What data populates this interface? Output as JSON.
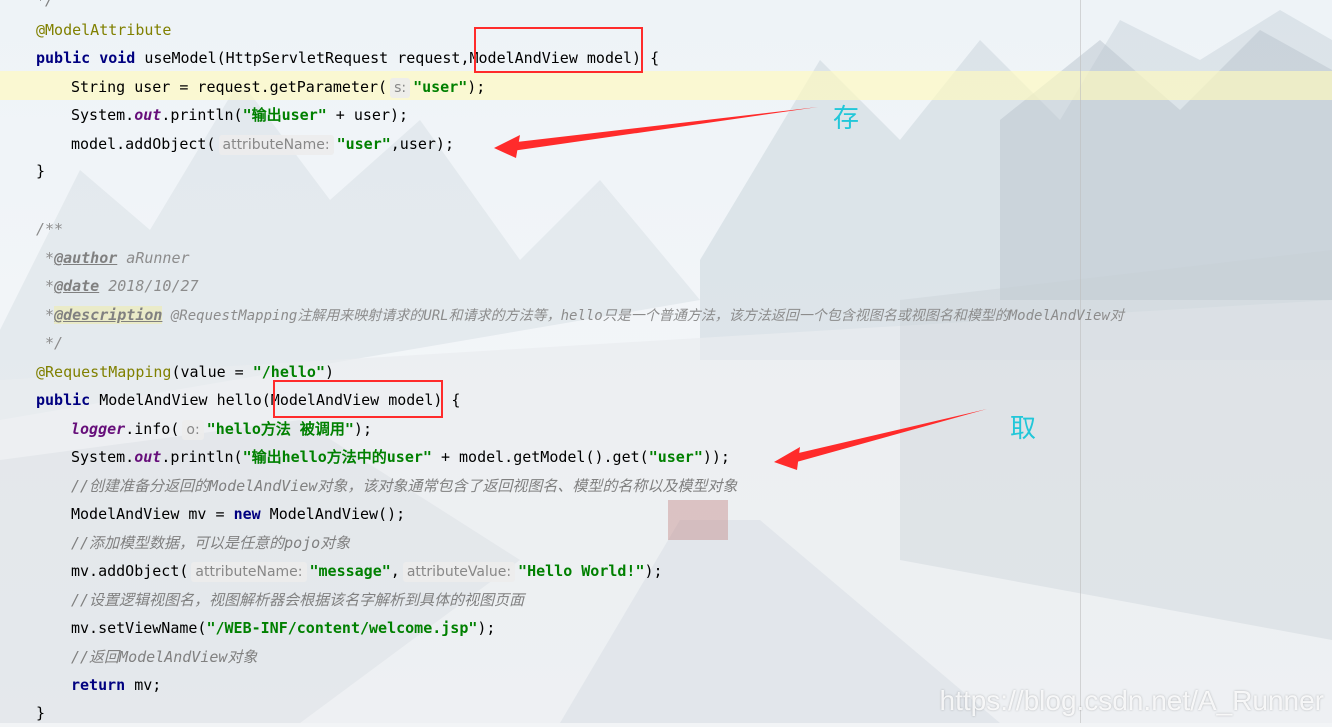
{
  "code_lines": {
    "l0": "*/",
    "l1_ann": "@ModelAttribute",
    "l2_kw": "public void",
    "l2_rest": " useModel(HttpServletRequest request,ModelAndView model) {",
    "l3_a": "String user = request.getParameter(",
    "l3_hint": "s:",
    "l3_str": "\"user\"",
    "l3_b": ");",
    "l4_a": "System.",
    "l4_fld": "out",
    "l4_b": ".println(",
    "l4_str": "\"输出user\"",
    "l4_c": " + user);",
    "l5_a": "model.addObject(",
    "l5_hint": "attributeName:",
    "l5_str": "\"user\"",
    "l5_b": ",user);",
    "l6": "}",
    "l8": "/**",
    "l9_star": " *",
    "l9_tag": "@author",
    "l9_rest": " aRunner",
    "l10_star": " *",
    "l10_tag": "@date",
    "l10_rest": " 2018/10/27",
    "l11_star": " *",
    "l11_tag": "@description",
    "l11_rest": " @RequestMapping注解用来映射请求的URL和请求的方法等，hello只是一个普通方法，该方法返回一个包含视图名或视图名和模型的ModelAndView对",
    "l12": " */",
    "l13_ann": "@RequestMapping",
    "l13_a": "(value = ",
    "l13_str": "\"/hello\"",
    "l13_b": ")",
    "l14_kw": "public",
    "l14_rest": " ModelAndView hello(ModelAndView model) {",
    "l15_fld": "logger",
    "l15_a": ".info(",
    "l15_hint": "o:",
    "l15_str": "\"hello方法 被调用\"",
    "l15_b": ");",
    "l16_a": "System.",
    "l16_fld": "out",
    "l16_b": ".println(",
    "l16_str": "\"输出hello方法中的user\"",
    "l16_c": " + model.getModel().get(",
    "l16_str2": "\"user\"",
    "l16_d": "));",
    "l17": "//创建准备分返回的ModelAndView对象，该对象通常包含了返回视图名、模型的名称以及模型对象",
    "l18_a": "ModelAndView mv = ",
    "l18_kw": "new",
    "l18_b": " ModelAndView();",
    "l19": "//添加模型数据，可以是任意的pojo对象",
    "l20_a": "mv.addObject(",
    "l20_hint1": "attributeName:",
    "l20_str1": "\"message\"",
    "l20_b": ",",
    "l20_hint2": "attributeValue:",
    "l20_str2": "\"Hello World!\"",
    "l20_c": ");",
    "l21": "//设置逻辑视图名，视图解析器会根据该名字解析到具体的视图页面",
    "l22_a": "mv.setViewName(",
    "l22_str": "\"/WEB-INF/content/welcome.jsp\"",
    "l22_b": ");",
    "l23": "//返回ModelAndView对象",
    "l24_kw": "return",
    "l24_rest": " mv;",
    "l25": "}"
  },
  "annotations": {
    "store_label": "存",
    "fetch_label": "取",
    "arrow_color": "#ff2b2b",
    "label_color": "#22c7d9"
  },
  "watermark": "https://blog.csdn.net/A_Runner"
}
